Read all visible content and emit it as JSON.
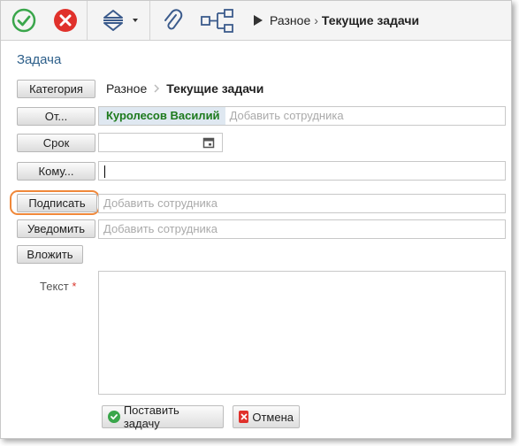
{
  "toolbar": {
    "breadcrumb_root": "Разное",
    "breadcrumb_sep": "›",
    "breadcrumb_current": "Текущие задачи"
  },
  "form": {
    "title": "Задача",
    "category_button": "Категория",
    "category_path_root": "Разное",
    "category_path_current": "Текущие задачи",
    "from_button": "От...",
    "from_person": "Куролесов Василий",
    "from_placeholder": "Добавить сотрудника",
    "deadline_button": "Срок",
    "deadline_value": "",
    "to_button": "Кому...",
    "to_value": "",
    "sign_button": "Подписать",
    "sign_placeholder": "Добавить сотрудника",
    "notify_button": "Уведомить",
    "notify_placeholder": "Добавить сотрудника",
    "attach_button": "Вложить",
    "text_label": "Текст",
    "text_required": "*",
    "text_value": ""
  },
  "actions": {
    "submit_label": "Поставить задачу",
    "cancel_label": "Отмена"
  },
  "colors": {
    "accent_title": "#2d5f8a",
    "ok_green": "#3aa64b",
    "cancel_red": "#e0312b",
    "highlight_orange": "#f0883a",
    "person_green": "#1d7a1d"
  }
}
